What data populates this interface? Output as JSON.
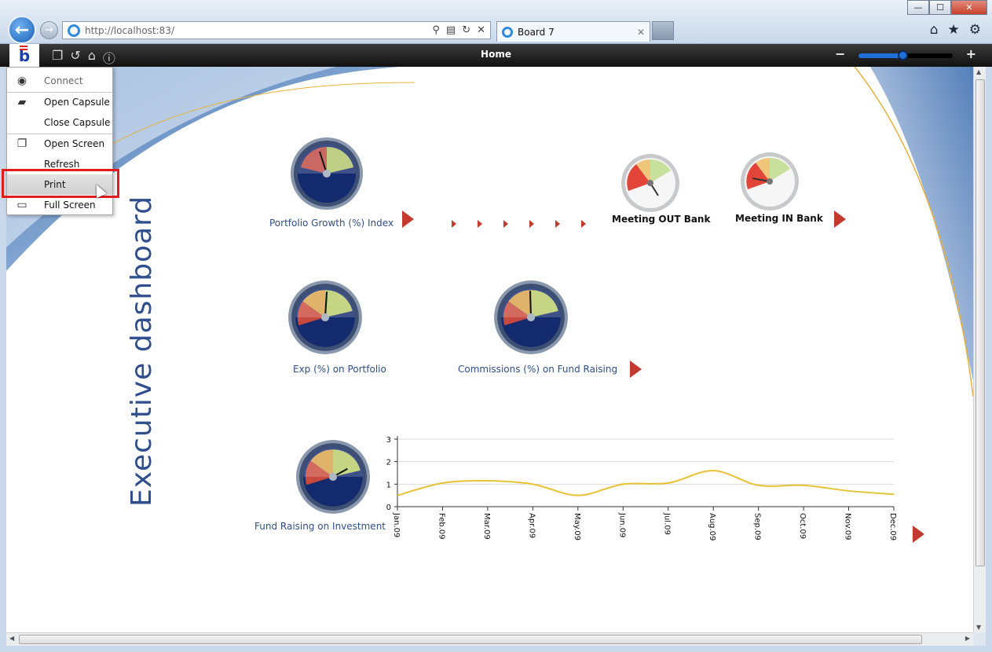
{
  "browser": {
    "url": "http://localhost:83/",
    "tab_title": "Board 7",
    "window_controls": [
      "minimize-icon",
      "maximize-icon",
      "close-icon"
    ],
    "toolbar_icons": [
      "home-icon",
      "favorites-star-icon",
      "settings-gear-icon"
    ]
  },
  "app": {
    "title": "Home",
    "toolbar_icons": [
      "open-screen-icon",
      "refresh-icon",
      "home-icon",
      "info-icon"
    ],
    "zoom": {
      "minus": "−",
      "plus": "+",
      "level": 0.47
    }
  },
  "menu": {
    "items": [
      {
        "label": "Connect",
        "icon": "globe-icon",
        "disabled": true
      },
      {
        "label": "Open Capsule",
        "icon": "folder-open-icon"
      },
      {
        "label": "Close Capsule",
        "icon": ""
      },
      {
        "label": "Open Screen",
        "icon": "open-screen-icon"
      },
      {
        "label": "Refresh",
        "icon": ""
      },
      {
        "label": "Print",
        "icon": "",
        "hovered": true
      },
      {
        "label": "Full Screen",
        "icon": "full-screen-icon"
      }
    ]
  },
  "dashboard": {
    "vertical_title": "Executive dashboard",
    "gauges": [
      {
        "label": "Portfolio Growth (%) Index"
      },
      {
        "label": "Meeting OUT Bank"
      },
      {
        "label": "Meeting IN Bank"
      },
      {
        "label": "Exp (%) on Portfolio"
      },
      {
        "label": "Commissions (%) on Fund Raising"
      },
      {
        "label": "Fund Raising on Investment"
      }
    ]
  },
  "chart_data": {
    "type": "line",
    "x": [
      "Jan.09",
      "Feb.09",
      "Mar.09",
      "Apr.09",
      "May.09",
      "Jun.09",
      "Jul.09",
      "Aug.09",
      "Sep.09",
      "Oct.09",
      "Nov.09",
      "Dec.09"
    ],
    "series": [
      {
        "values": [
          0.5,
          1.05,
          1.15,
          1.0,
          0.5,
          1.0,
          1.05,
          1.6,
          0.95,
          0.95,
          0.7,
          0.55
        ]
      }
    ],
    "ylim": [
      0,
      3
    ],
    "yticks": [
      "0",
      "1",
      "2",
      "3"
    ],
    "line_color": "#e6c234",
    "grid": true
  },
  "colors": {
    "accent": "#2e4e8e",
    "arrow": "#c43a2e",
    "highlight": "#e21b1b"
  }
}
